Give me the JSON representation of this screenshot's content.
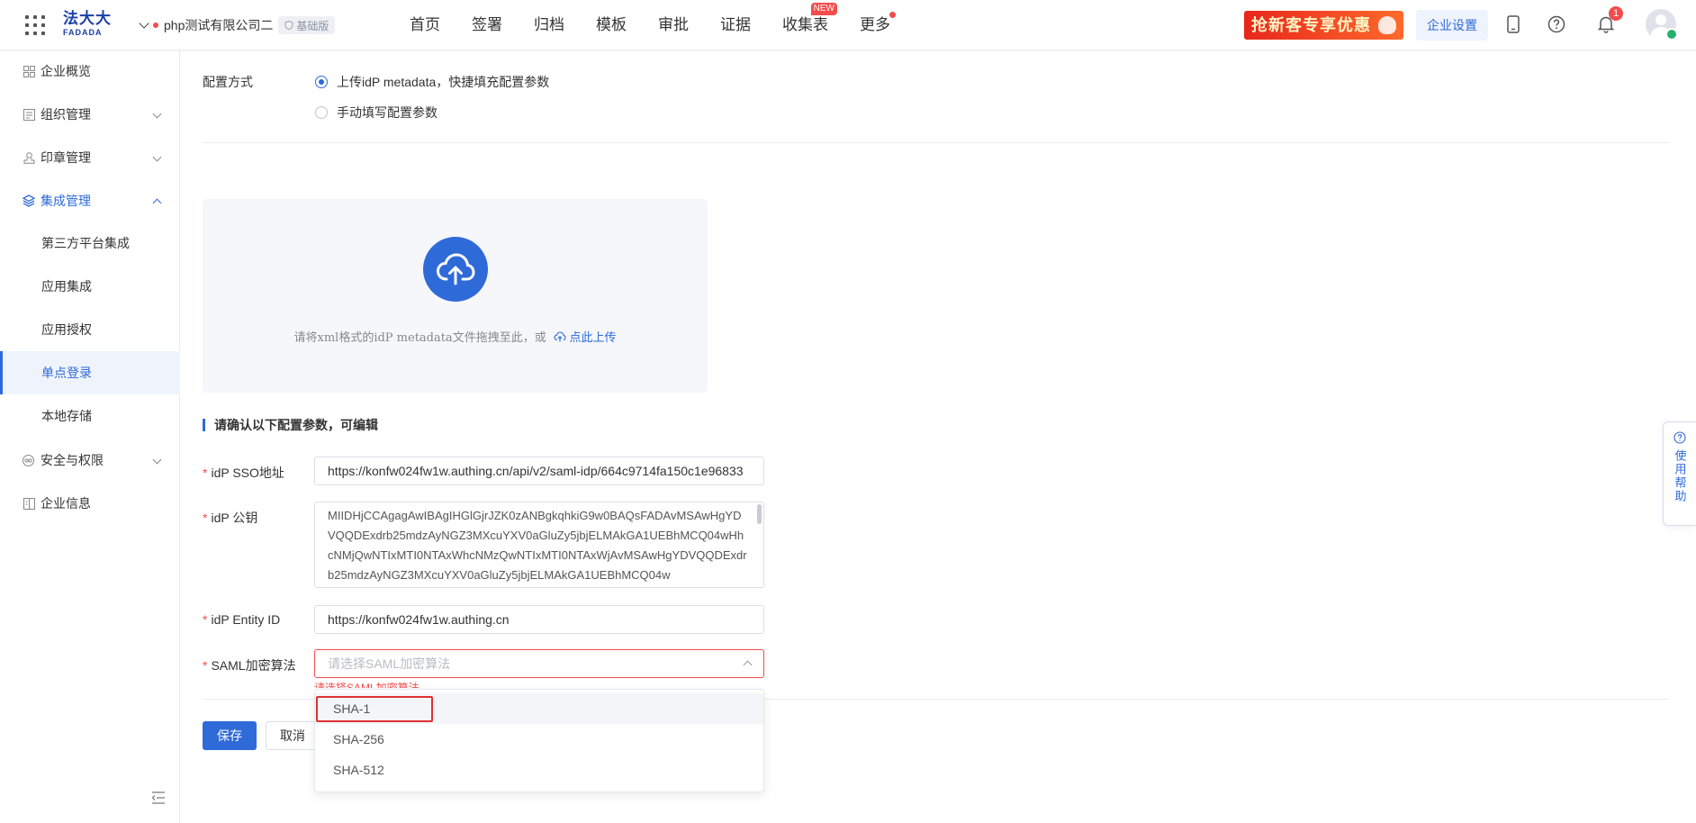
{
  "header": {
    "logo_cn": "法大大",
    "logo_en": "FADADA",
    "company_name": "php测试有限公司二",
    "edition": "基础版",
    "nav": [
      {
        "label": "首页"
      },
      {
        "label": "签署"
      },
      {
        "label": "归档"
      },
      {
        "label": "模板"
      },
      {
        "label": "审批"
      },
      {
        "label": "证据"
      },
      {
        "label": "收集表",
        "badge": "NEW"
      },
      {
        "label": "更多"
      }
    ],
    "promo_text": "抢新客专享优惠",
    "settings_label": "企业设置",
    "notification_count": "1"
  },
  "sidebar": {
    "items": [
      {
        "label": "企业概览"
      },
      {
        "label": "组织管理"
      },
      {
        "label": "印章管理"
      },
      {
        "label": "集成管理"
      },
      {
        "label": "安全与权限"
      },
      {
        "label": "企业信息"
      }
    ],
    "sub_items": [
      {
        "label": "第三方平台集成"
      },
      {
        "label": "应用集成"
      },
      {
        "label": "应用授权"
      },
      {
        "label": "单点登录"
      },
      {
        "label": "本地存储"
      }
    ]
  },
  "form": {
    "config_method_label": "配置方式",
    "option_upload": "上传idP metadata，快捷填充配置参数",
    "option_manual": "手动填写配置参数",
    "drop_text": "请将xml格式的idP metadata文件拖拽至此，或",
    "drop_link": "点此上传",
    "section_title": "请确认以下配置参数，可编辑",
    "sso_label": "idP SSO地址",
    "sso_value": "https://konfw024fw1w.authing.cn/api/v2/saml-idp/664c9714fa150c1e96833",
    "pubkey_label": "idP 公钥",
    "pubkey_value": "MIIDHjCCAgagAwIBAgIHGlGjrJZK0zANBgkqhkiG9w0BAQsFADAvMSAwHgYDVQQDExdrb25mdzAyNGZ3MXcuYXV0aGluZy5jbjELMAkGA1UEBhMCQ04wHhcNMjQwNTIxMTI0NTAxWhcNMzQwNTIxMTI0NTAxWjAvMSAwHgYDVQQDExdrb25mdzAyNGZ3MXcuYXV0aGluZy5jbjELMAkGA1UEBhMCQ04w",
    "entity_label": "idP Entity ID",
    "entity_value": "https://konfw024fw1w.authing.cn",
    "algo_label": "SAML加密算法",
    "algo_placeholder": "请选择SAML加密算法",
    "algo_error": "请选择SAML加密算法",
    "algo_options": [
      "SHA-1",
      "SHA-256",
      "SHA-512"
    ],
    "save_label": "保存",
    "cancel_label": "取消"
  },
  "help": {
    "label": "使用帮助"
  },
  "colors": {
    "primary": "#2f6ad9",
    "error": "#f34c4c",
    "highlight": "#e03131"
  }
}
